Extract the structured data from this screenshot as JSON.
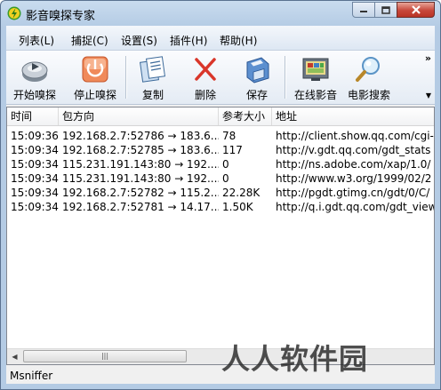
{
  "window": {
    "title": "影音嗅探专家"
  },
  "menu": [
    "列表(L)",
    "捕捉(C)",
    "设置(S)",
    "插件(H)",
    "帮助(H)"
  ],
  "toolbar": {
    "start": "开始嗅探",
    "stop": "停止嗅探",
    "copy": "复制",
    "delete": "删除",
    "save": "保存",
    "online": "在线影音",
    "movie_search": "电影搜索",
    "more": "»"
  },
  "table": {
    "columns": [
      "时间",
      "包方向",
      "参考大小",
      "地址"
    ],
    "rows": [
      [
        "15:09:36",
        "192.168.2.7:52786 → 183.6...",
        "78",
        "http://client.show.qq.com/cgi-"
      ],
      [
        "15:09:34",
        "192.168.2.7:52785 → 183.6...",
        "117",
        "http://v.gdt.qq.com/gdt_stats"
      ],
      [
        "15:09:34",
        "115.231.191.143:80 → 192....",
        "0",
        "http://ns.adobe.com/xap/1.0/"
      ],
      [
        "15:09:34",
        "115.231.191.143:80 → 192....",
        "0",
        "http://www.w3.org/1999/02/2"
      ],
      [
        "15:09:34",
        "192.168.2.7:52782 → 115.2...",
        "22.28K",
        "http://pgdt.gtimg.cn/gdt/0/C/"
      ],
      [
        "15:09:34",
        "192.168.2.7:52781 → 14.17....",
        "1.50K",
        "http://q.i.gdt.qq.com/gdt_view"
      ]
    ]
  },
  "status": {
    "text": "Msniffer"
  },
  "watermark": "人人软件园"
}
